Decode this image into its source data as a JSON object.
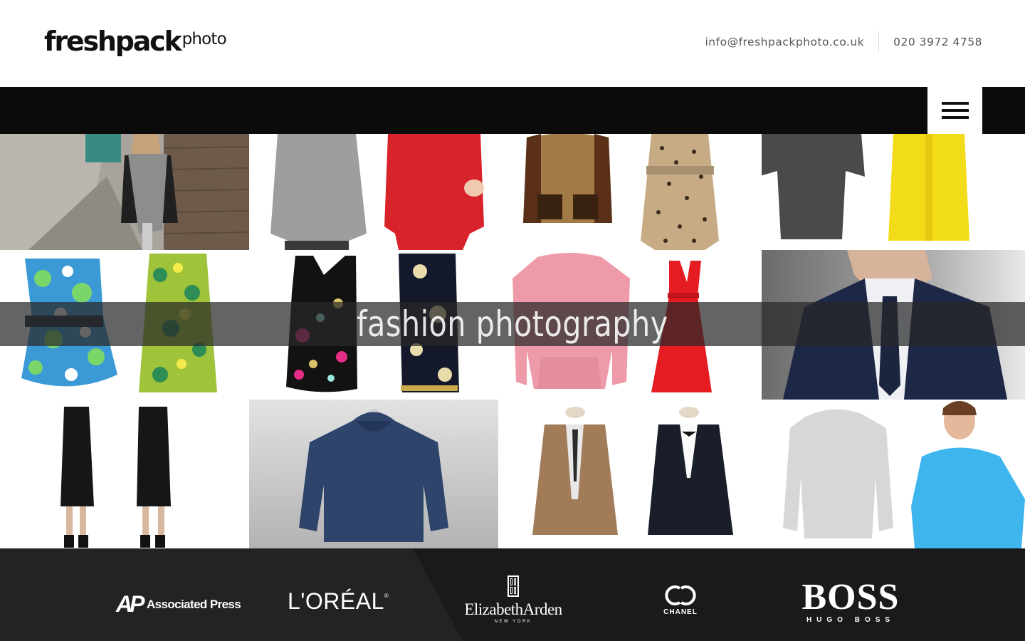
{
  "header": {
    "logo_main": "freshpack",
    "logo_sub": "photo",
    "email": "info@freshpackphoto.co.uk",
    "phone": "020 3972 4758"
  },
  "nav": {
    "menu_icon": "hamburger-menu-icon"
  },
  "hero": {
    "title": "fashion photography"
  },
  "clients": {
    "ap_mark": "AP",
    "ap_name": "Associated Press",
    "loreal": "L'ORÉAL",
    "loreal_reg": "®",
    "elizabeth_arden": "ElizabethArden",
    "elizabeth_arden_sub": "NEW YORK",
    "chanel": "CHANEL",
    "boss": "BOSS",
    "boss_sub": "HUGO BOSS"
  },
  "colors": {
    "navbar": "#0b0b0b",
    "footer": "#232323",
    "band": "#282828"
  }
}
